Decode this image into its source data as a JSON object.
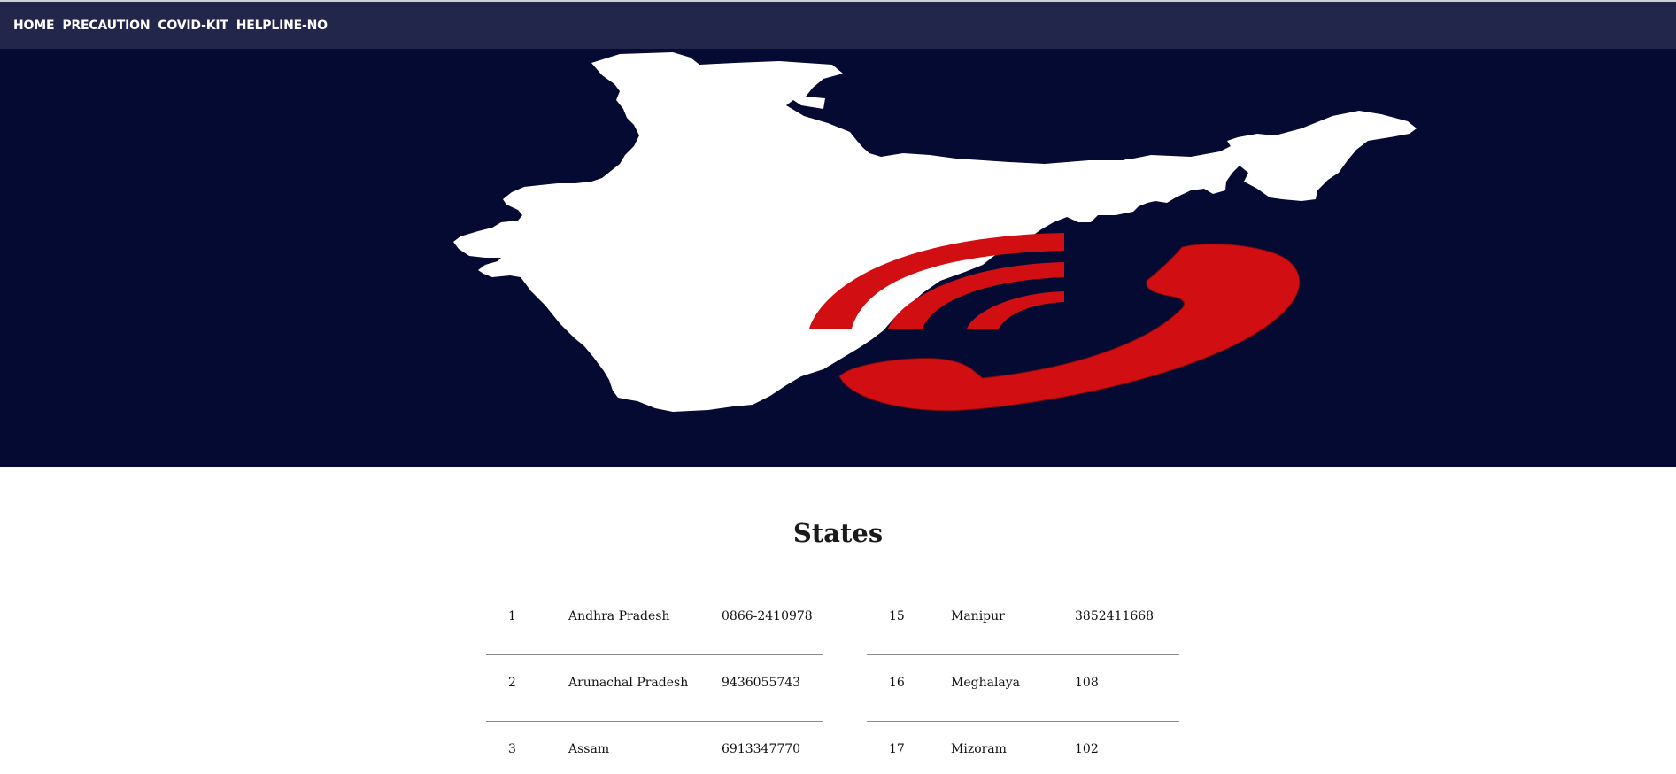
{
  "nav": {
    "items": [
      {
        "label": "HOME"
      },
      {
        "label": "PRECAUTION"
      },
      {
        "label": "COVID-KIT"
      },
      {
        "label": "HELPLINE-NO"
      }
    ]
  },
  "hero": {
    "image": "india-map-helpline-phone-illustration",
    "colors": {
      "background": "#050a32",
      "map": "#ffffff",
      "phone": "#d10f12"
    }
  },
  "states_section": {
    "title": "States",
    "left_rows": [
      {
        "no": "1",
        "state": "Andhra Pradesh",
        "phone": "0866-2410978"
      },
      {
        "no": "2",
        "state": "Arunachal Pradesh",
        "phone": "9436055743"
      },
      {
        "no": "3",
        "state": "Assam",
        "phone": "6913347770"
      }
    ],
    "right_rows": [
      {
        "no": "15",
        "state": "Manipur",
        "phone": "3852411668"
      },
      {
        "no": "16",
        "state": "Meghalaya",
        "phone": "108"
      },
      {
        "no": "17",
        "state": "Mizoram",
        "phone": "102"
      }
    ]
  }
}
